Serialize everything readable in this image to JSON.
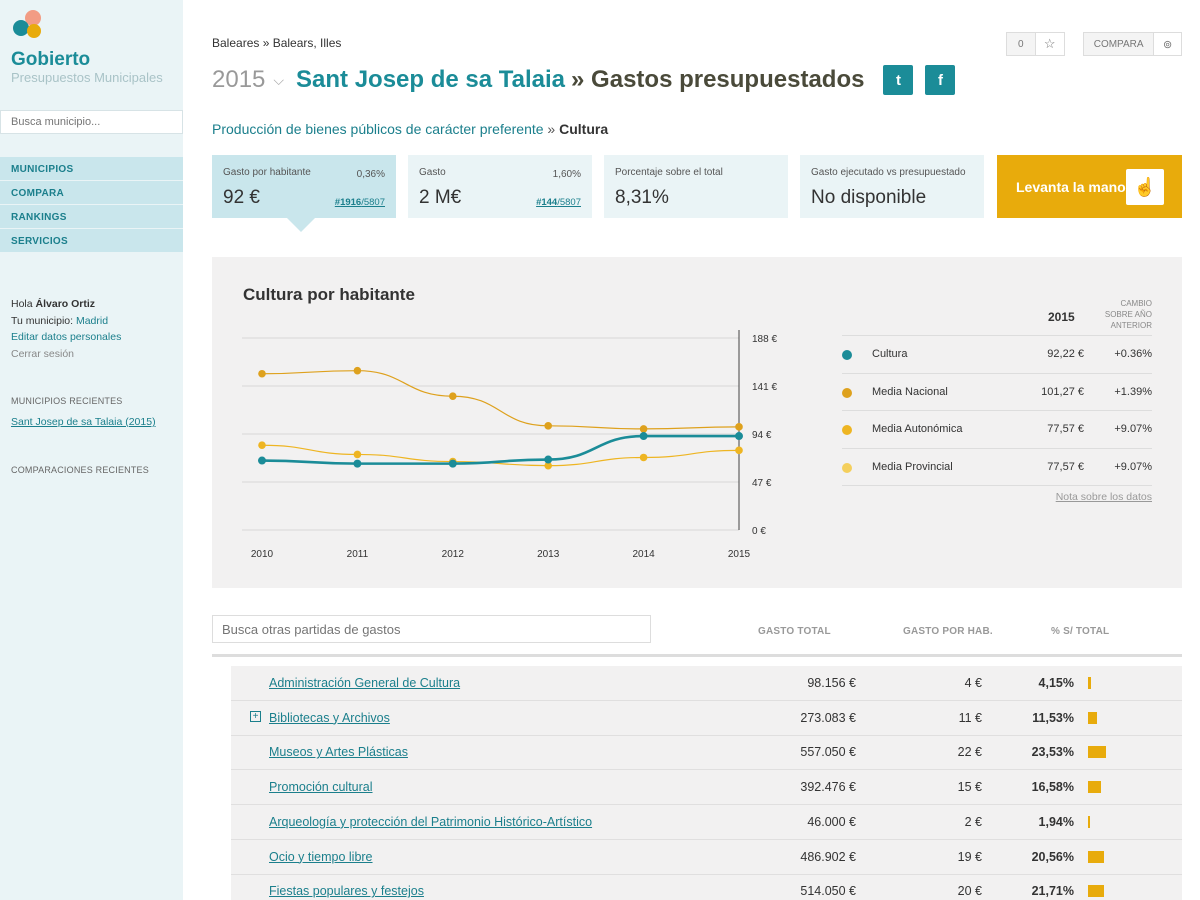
{
  "sidebar": {
    "brand": "Gobierto",
    "brand_sub": "Presupuestos Municipales",
    "search_placeholder": "Busca municipio...",
    "nav": [
      "MUNICIPIOS",
      "COMPARA",
      "RANKINGS",
      "SERVICIOS"
    ],
    "user": {
      "greeting": "Hola ",
      "name": "Álvaro Ortiz",
      "municipio_label": "Tu municipio: ",
      "municipio": "Madrid",
      "edit": "Editar datos personales",
      "logout": "Cerrar sesión"
    },
    "recent_head": "MUNICIPIOS RECIENTES",
    "recent_link": "Sant Josep de sa Talaia (2015)",
    "comparisons_head": "COMPARACIONES RECIENTES"
  },
  "header": {
    "breadcrumb": "Baleares » Balears, Illes",
    "year": "2015",
    "municipality": "Sant Josep de sa Talaia",
    "title_rest": "» Gastos presupuestados",
    "twitter": "t",
    "facebook": "f",
    "follow_count": "0",
    "compare": "COMPARA"
  },
  "subcrumb": {
    "parent": "Producción de bienes públicos de carácter preferente",
    "sep": " » ",
    "current": "Cultura"
  },
  "kpis": [
    {
      "label": "Gasto por habitante",
      "pct": "0,36%",
      "value": "92 €",
      "rank": "#1916",
      "rank_total": "/5807"
    },
    {
      "label": "Gasto",
      "pct": "1,60%",
      "value": "2 M€",
      "rank": "#144",
      "rank_total": "/5807"
    },
    {
      "label": "Porcentaje sobre el total",
      "value": "8,31%"
    },
    {
      "label": "Gasto ejecutado vs presupuestado",
      "value": "No disponible"
    }
  ],
  "raise_hand": "Levanta la mano",
  "chart": {
    "title": "Cultura por habitante",
    "legend_year": "2015",
    "legend_change": [
      "CAMBIO",
      "SOBRE AÑO",
      "ANTERIOR"
    ],
    "note": "Nota sobre los datos"
  },
  "chart_data": {
    "type": "line",
    "x": [
      "2010",
      "2011",
      "2012",
      "2013",
      "2014",
      "2015"
    ],
    "y_ticks": [
      "188 €",
      "141 €",
      "94 €",
      "47 €",
      "0 €"
    ],
    "ylim": [
      0,
      188
    ],
    "series": [
      {
        "name": "Cultura",
        "color": "#1b8c98",
        "values": [
          68,
          65,
          65,
          69,
          92,
          92
        ],
        "legend_value": "92,22 €",
        "change": "+0.36%"
      },
      {
        "name": "Media Nacional",
        "color": "#dea11d",
        "values": [
          153,
          156,
          131,
          102,
          99,
          101
        ],
        "legend_value": "101,27 €",
        "change": "+1.39%"
      },
      {
        "name": "Media Autonómica",
        "color": "#eeb522",
        "values": [
          83,
          74,
          67,
          63,
          71,
          78
        ],
        "legend_value": "77,57 €",
        "change": "+9.07%"
      },
      {
        "name": "Media Provincial",
        "color": "#f4cf5c",
        "values": [],
        "legend_value": "77,57 €",
        "change": "+9.07%"
      }
    ],
    "grid": true
  },
  "table": {
    "search_placeholder": "Busca otras partidas de gastos",
    "headers": [
      "GASTO TOTAL",
      "GASTO POR HAB.",
      "% S/ TOTAL"
    ],
    "rows": [
      {
        "name": "Administración General de Cultura",
        "total": "98.156 €",
        "per_hab": "4 €",
        "pct": "4,15%",
        "share": 4.15,
        "expand": false
      },
      {
        "name": "Bibliotecas y Archivos",
        "total": "273.083 €",
        "per_hab": "11 €",
        "pct": "11,53%",
        "share": 11.53,
        "expand": true
      },
      {
        "name": "Museos y Artes Plásticas",
        "total": "557.050 €",
        "per_hab": "22 €",
        "pct": "23,53%",
        "share": 23.53,
        "expand": false
      },
      {
        "name": "Promoción cultural",
        "total": "392.476 €",
        "per_hab": "15 €",
        "pct": "16,58%",
        "share": 16.58,
        "expand": false
      },
      {
        "name": "Arqueología y protección del Patrimonio Histórico-Artístico",
        "total": "46.000 €",
        "per_hab": "2 €",
        "pct": "1,94%",
        "share": 1.94,
        "expand": false
      },
      {
        "name": "Ocio y tiempo libre",
        "total": "486.902 €",
        "per_hab": "19 €",
        "pct": "20,56%",
        "share": 20.56,
        "expand": false
      },
      {
        "name": "Fiestas populares y festejos",
        "total": "514.050 €",
        "per_hab": "20 €",
        "pct": "21,71%",
        "share": 21.71,
        "expand": false
      }
    ]
  }
}
